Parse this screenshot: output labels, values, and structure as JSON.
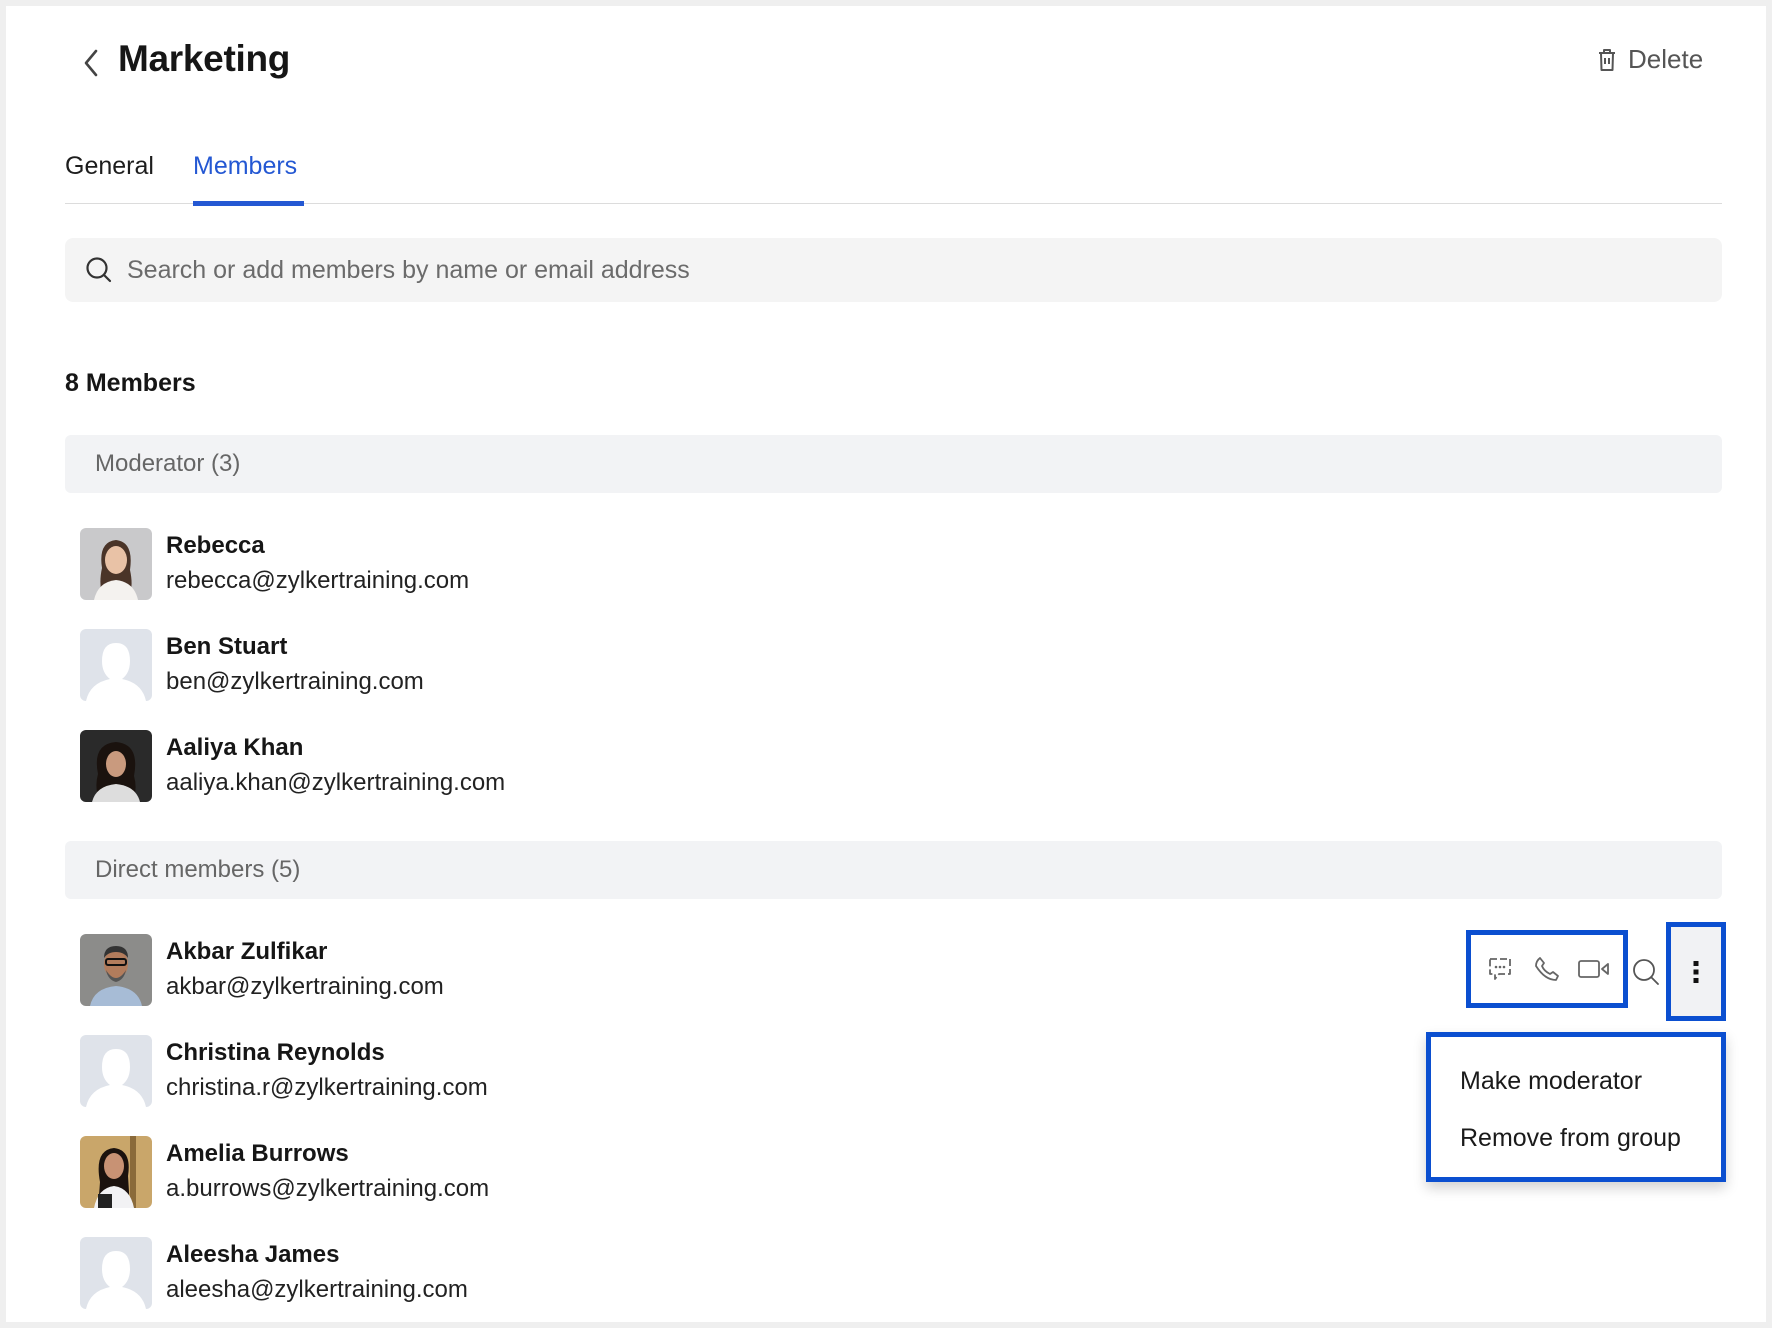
{
  "header": {
    "title": "Marketing",
    "back_icon": "chevron-left-icon",
    "delete_label": "Delete",
    "delete_icon": "trash-icon"
  },
  "tabs": [
    {
      "label": "General",
      "active": false
    },
    {
      "label": "Members",
      "active": true
    }
  ],
  "accent_color": "#2458d3",
  "highlight_color": "#0b4fd0",
  "search": {
    "placeholder": "Search or add members by name or email address",
    "value": ""
  },
  "members_count_label": "8 Members",
  "groups": [
    {
      "label": "Moderator (3)",
      "members": [
        {
          "name": "Rebecca",
          "email": "rebecca@zylkertraining.com",
          "avatar": "photo"
        },
        {
          "name": "Ben Stuart",
          "email": "ben@zylkertraining.com",
          "avatar": "placeholder"
        },
        {
          "name": "Aaliya Khan",
          "email": "aaliya.khan@zylkertraining.com",
          "avatar": "photo"
        }
      ]
    },
    {
      "label": "Direct members (5)",
      "members": [
        {
          "name": "Akbar Zulfikar",
          "email": "akbar@zylkertraining.com",
          "avatar": "photo"
        },
        {
          "name": "Christina Reynolds",
          "email": "christina.r@zylkertraining.com",
          "avatar": "placeholder"
        },
        {
          "name": "Amelia Burrows",
          "email": "a.burrows@zylkertraining.com",
          "avatar": "photo"
        },
        {
          "name": "Aleesha James",
          "email": "aleesha@zylkertraining.com",
          "avatar": "placeholder"
        }
      ]
    }
  ],
  "row_actions": {
    "icons": [
      "chat-icon",
      "phone-icon",
      "video-icon",
      "search-icon",
      "more-vertical-icon"
    ]
  },
  "context_menu": {
    "items": [
      "Make moderator",
      "Remove from group"
    ]
  }
}
